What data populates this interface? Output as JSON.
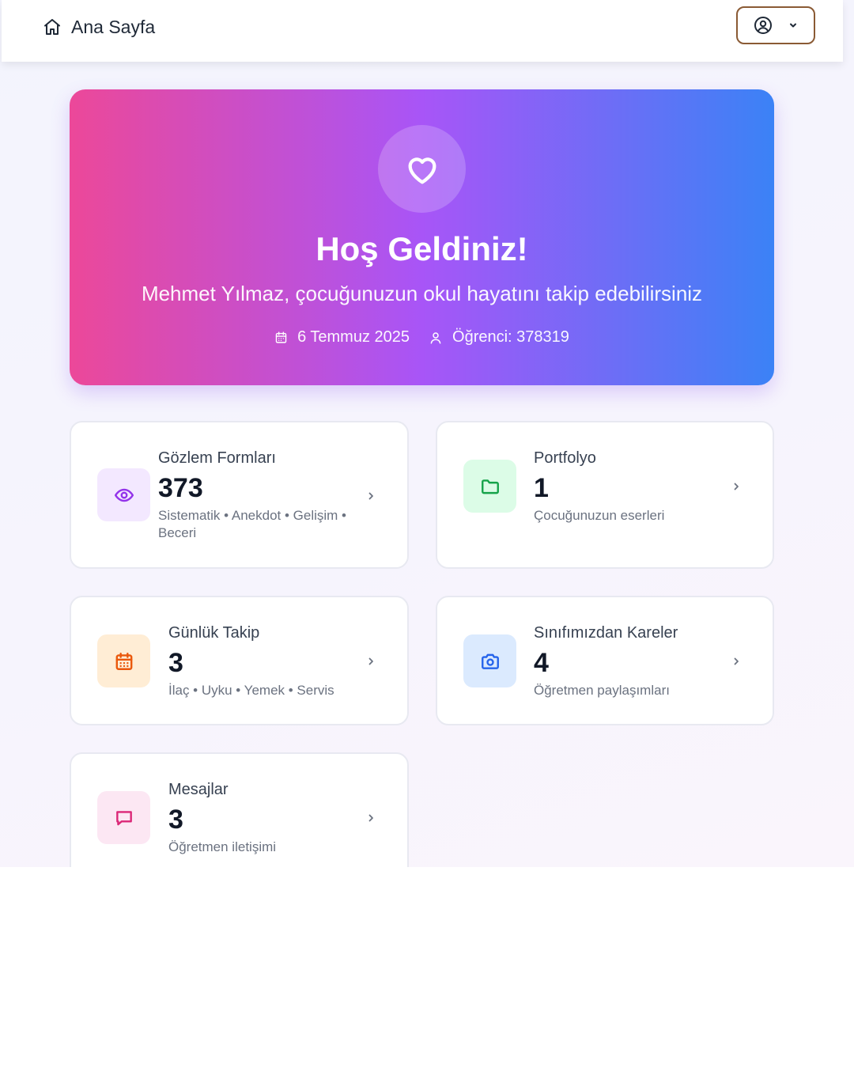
{
  "topbar": {
    "home_label": "Ana Sayfa",
    "home_icon": "home-icon",
    "user_icon": "user-circle-icon",
    "dropdown_icon": "chevron-down-icon"
  },
  "hero": {
    "icon": "heart-icon",
    "title": "Hoş Geldiniz!",
    "subtitle": "Mehmet Yılmaz, çocuğunuzun okul hayatını takip edebilirsiniz",
    "date": "6 Temmuz 2025",
    "student": "Öğrenci: 378319",
    "gradient": [
      "#ec4899",
      "#a855f7",
      "#3b82f6"
    ]
  },
  "cards": [
    {
      "title": "Gözlem Formları",
      "count": "373",
      "description": "Sistematik • Anekdot • Gelişim • Beceri",
      "icon": "eye-icon",
      "icon_color": "#9333ea",
      "icon_bg": "#f3e8ff"
    },
    {
      "title": "Portfolyo",
      "count": "1",
      "description": "Çocuğunuzun eserleri",
      "icon": "folder-icon",
      "icon_color": "#16a34a",
      "icon_bg": "#dcfce7"
    },
    {
      "title": "Günlük Takip",
      "count": "3",
      "description": "İlaç • Uyku • Yemek • Servis",
      "icon": "calendar-icon",
      "icon_color": "#ea580c",
      "icon_bg": "#ffedd5"
    },
    {
      "title": "Sınıfımızdan Kareler",
      "count": "4",
      "description": "Öğretmen paylaşımları",
      "icon": "camera-icon",
      "icon_color": "#2563eb",
      "icon_bg": "#dbeafe"
    },
    {
      "title": "Mesajlar",
      "count": "3",
      "description": "Öğretmen iletişimi",
      "icon": "message-icon",
      "icon_color": "#db2777",
      "icon_bg": "#fce7f3"
    }
  ]
}
